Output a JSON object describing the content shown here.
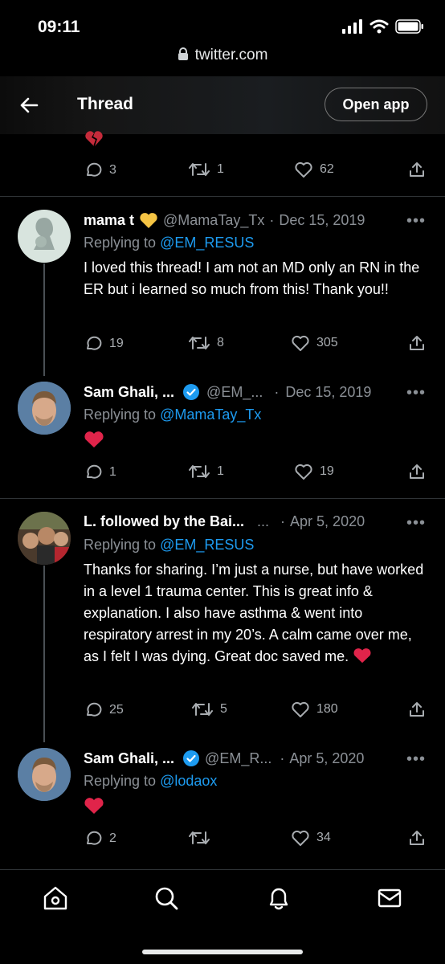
{
  "status_bar": {
    "time": "09:11"
  },
  "browser": {
    "url": "twitter.com"
  },
  "header": {
    "title": "Thread",
    "open_app_label": "Open app"
  },
  "colors": {
    "accent": "#1d9bf0",
    "heart": "#e0245e",
    "verified": "#1d9bf0",
    "secondary_text": "#8b9096"
  },
  "prev_tweet": {
    "emoji": "broken-heart",
    "replies": "3",
    "retweets": "1",
    "likes": "62"
  },
  "tweets": [
    {
      "name": "mama t",
      "badge_emoji": "yellow-heart",
      "handle": "@MamaTay_Tx",
      "sep": "·",
      "date": "Dec 15, 2019",
      "replying_prefix": "Replying to ",
      "replying_to": "@EM_RESUS",
      "text": "I loved this thread! I am not an MD only an RN in the ER but i learned so much from this! Thank you!!",
      "replies": "19",
      "retweets": "8",
      "likes": "305"
    },
    {
      "name": "Sam Ghali, ...",
      "verified": true,
      "handle": "@EM_...",
      "sep": "·",
      "date": "Dec 15, 2019",
      "replying_prefix": "Replying to ",
      "replying_to": "@MamaTay_Tx",
      "emoji": "red-heart",
      "replies": "1",
      "retweets": "1",
      "likes": "19"
    },
    {
      "name": "L. followed by the Bai...",
      "handle": "...",
      "sep": "·",
      "date": "Apr 5, 2020",
      "replying_prefix": "Replying to ",
      "replying_to": "@EM_RESUS",
      "text": "Thanks for sharing. I’m just a nurse, but have worked in a level 1 trauma center. This is great info & explanation.  I also have asthma & went into respiratory arrest in my 20’s.  A calm came over me, as I felt I was dying. Great doc saved me.",
      "replies": "25",
      "retweets": "5",
      "likes": "180"
    },
    {
      "name": "Sam Ghali, ...",
      "verified": true,
      "handle": "@EM_R...",
      "sep": "·",
      "date": "Apr 5, 2020",
      "replying_prefix": "Replying to ",
      "replying_to": "@lodaox",
      "emoji": "red-heart",
      "replies": "2",
      "retweets": "",
      "likes": "34"
    }
  ],
  "more_label": "•••",
  "nav": [
    "home-icon",
    "search-icon",
    "notifications-icon",
    "messages-icon"
  ]
}
